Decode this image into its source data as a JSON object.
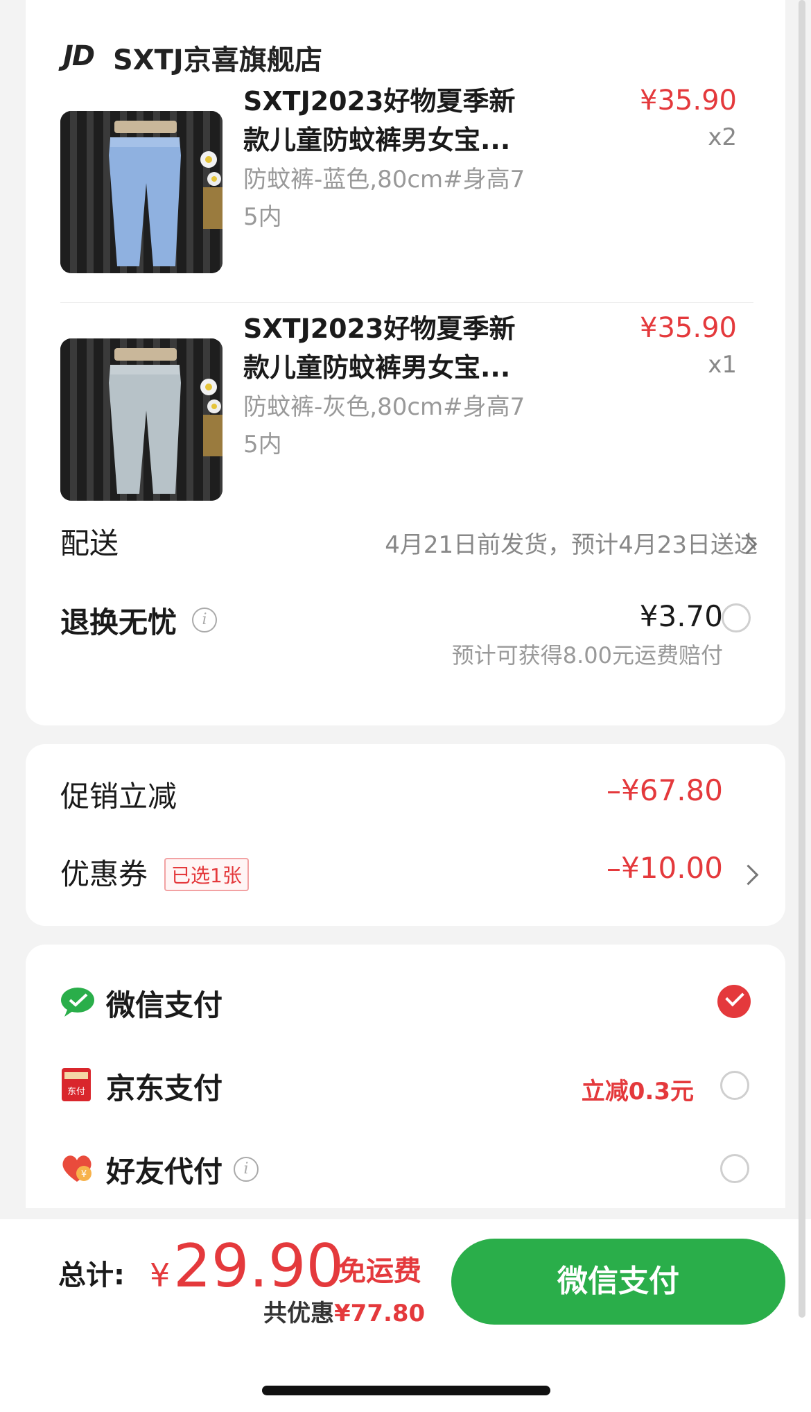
{
  "shop": {
    "logo": "JD",
    "name": "SXTJ京喜旗舰店"
  },
  "items": [
    {
      "title_line1": "SXTJ2023好物夏季新",
      "title_line2": "款儿童防蚊裤男女宝...",
      "spec_line1": "防蚊裤-蓝色,80cm#身高7",
      "spec_line2": "5内",
      "price": "¥35.90",
      "qty": "x2",
      "color": "#8fb1e0"
    },
    {
      "title_line1": "SXTJ2023好物夏季新",
      "title_line2": "款儿童防蚊裤男女宝...",
      "spec_line1": "防蚊裤-灰色,80cm#身高7",
      "spec_line2": "5内",
      "price": "¥35.90",
      "qty": "x1",
      "color": "#b7c2c8"
    }
  ],
  "delivery": {
    "label": "配送",
    "value": "4月21日前发货，预计4月23日送达"
  },
  "return_insurance": {
    "label": "退换无忧",
    "price": "¥3.70",
    "note": "预计可获得8.00元运费赔付"
  },
  "discounts": {
    "promo_label": "促销立减",
    "promo_value": "–¥67.80",
    "coupon_label": "优惠券",
    "coupon_badge": "已选1张",
    "coupon_value": "–¥10.00"
  },
  "payment_methods": [
    {
      "label": "微信支付",
      "icon": "wechat-pay-icon",
      "selected": true
    },
    {
      "label": "京东支付",
      "icon": "jd-pay-icon",
      "promo": "立减0.3元",
      "selected": false
    },
    {
      "label": "好友代付",
      "icon": "friend-pay-icon",
      "selected": false
    }
  ],
  "summary": {
    "total_label": "总计:",
    "currency": "¥",
    "total": "29.90",
    "free_shipping": "免运费",
    "saved_label": "共优惠",
    "saved_value": "¥77.80",
    "pay_button": "微信支付"
  },
  "colors": {
    "accent_red": "#e4393c",
    "wechat_green": "#2aae4a"
  }
}
